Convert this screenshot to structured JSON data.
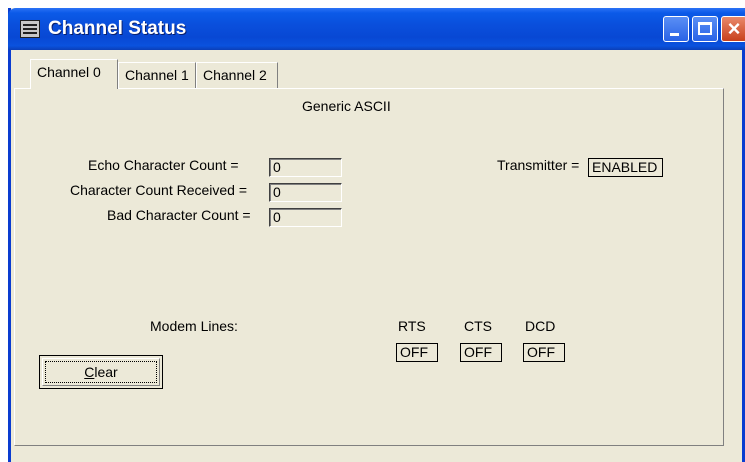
{
  "window": {
    "title": "Channel Status",
    "accent": "#0a4fdc"
  },
  "title_buttons": {
    "minimize": "minimize-icon",
    "maximize": "maximize-icon",
    "close": "close-icon"
  },
  "tabs": [
    {
      "label": "Channel 0",
      "active": true
    },
    {
      "label": "Channel 1",
      "active": false
    },
    {
      "label": "Channel 2",
      "active": false
    }
  ],
  "panel": {
    "mode": "Generic ASCII",
    "counts": [
      {
        "label": "Echo Character Count =",
        "value": "0"
      },
      {
        "label": "Character Count Received =",
        "value": "0"
      },
      {
        "label": "Bad Character Count =",
        "value": "0"
      }
    ],
    "transmitter": {
      "label": "Transmitter =",
      "value": "ENABLED"
    },
    "modem": {
      "label": "Modem Lines:",
      "lines": [
        {
          "name": "RTS",
          "value": "OFF"
        },
        {
          "name": "CTS",
          "value": "OFF"
        },
        {
          "name": "DCD",
          "value": "OFF"
        }
      ]
    },
    "clear_button": {
      "mnemonic": "C",
      "rest": "lear"
    }
  }
}
